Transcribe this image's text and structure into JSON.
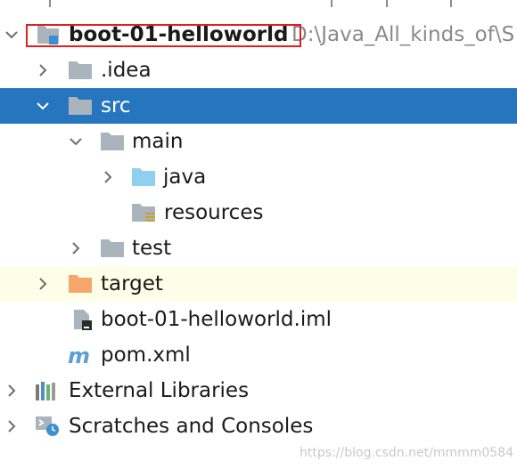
{
  "project_tree": {
    "root": {
      "name": "boot-01-helloworld",
      "path": "D:\\Java_All_kinds_of\\S"
    },
    "items": [
      {
        "label": ".idea"
      },
      {
        "label": "src"
      },
      {
        "label": "main"
      },
      {
        "label": "java"
      },
      {
        "label": "resources"
      },
      {
        "label": "test"
      },
      {
        "label": "target"
      },
      {
        "label": "boot-01-helloworld.iml"
      },
      {
        "label": "pom.xml"
      },
      {
        "label": "External Libraries"
      },
      {
        "label": "Scratches and Consoles"
      }
    ]
  },
  "watermark": "https://blog.csdn.net/mmmm0584",
  "colors": {
    "selection": "#2675bf",
    "excluded_row": "#fdfde8",
    "folder_gray": "#aab4bc",
    "source_folder_blue": "#8fd0ef",
    "excluded_folder_orange": "#f6a66b",
    "highlight_border": "#e02020"
  },
  "icons": {
    "root": "module-folder-icon",
    "folder": "folder-icon",
    "source_folder": "source-folder-icon",
    "resources_folder": "resources-folder-icon",
    "excluded_folder": "excluded-folder-icon",
    "iml_file": "iml-file-icon",
    "maven": "maven-icon",
    "libraries": "libraries-icon",
    "scratches": "scratches-icon"
  }
}
